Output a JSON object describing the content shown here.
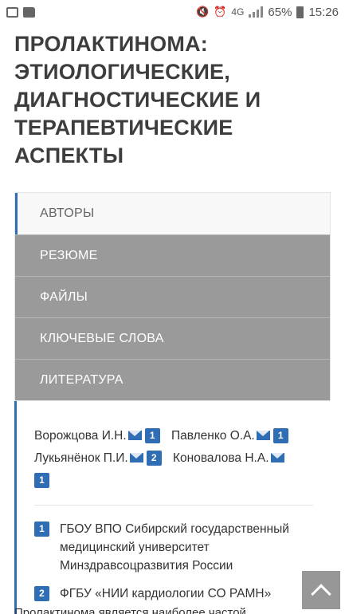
{
  "statusbar": {
    "network": "4G",
    "battery_percent": "65%",
    "time": "15:26"
  },
  "article": {
    "title": "ПРОЛАКТИНОМА: ЭТИОЛОГИЧЕСКИЕ, ДИАГНОСТИЧЕСКИЕ И ТЕРАПЕВТИЧЕСКИЕ АСПЕКТЫ"
  },
  "tabs": [
    {
      "label": "АВТОРЫ",
      "active": true
    },
    {
      "label": "РЕЗЮМЕ",
      "active": false
    },
    {
      "label": "ФАЙЛЫ",
      "active": false
    },
    {
      "label": "КЛЮЧЕВЫЕ СЛОВА",
      "active": false
    },
    {
      "label": "ЛИТЕРАТУРА",
      "active": false
    }
  ],
  "authors": [
    {
      "name": "Ворожцова И.Н.",
      "affiliation": "1"
    },
    {
      "name": "Павленко О.А.",
      "affiliation": "1"
    },
    {
      "name": "Лукьянёнок П.И.",
      "affiliation": "2"
    },
    {
      "name": "Коновалова Н.А.",
      "affiliation": "1"
    }
  ],
  "affiliations": [
    {
      "num": "1",
      "text": "ГБОУ ВПО Сибирский государственный медицинский университет Минздравсоцразвития России"
    },
    {
      "num": "2",
      "text": "ФГБУ «НИИ кардиологии СО РАМН»"
    }
  ],
  "cut_text": "Пролактинома является наиболее частой"
}
